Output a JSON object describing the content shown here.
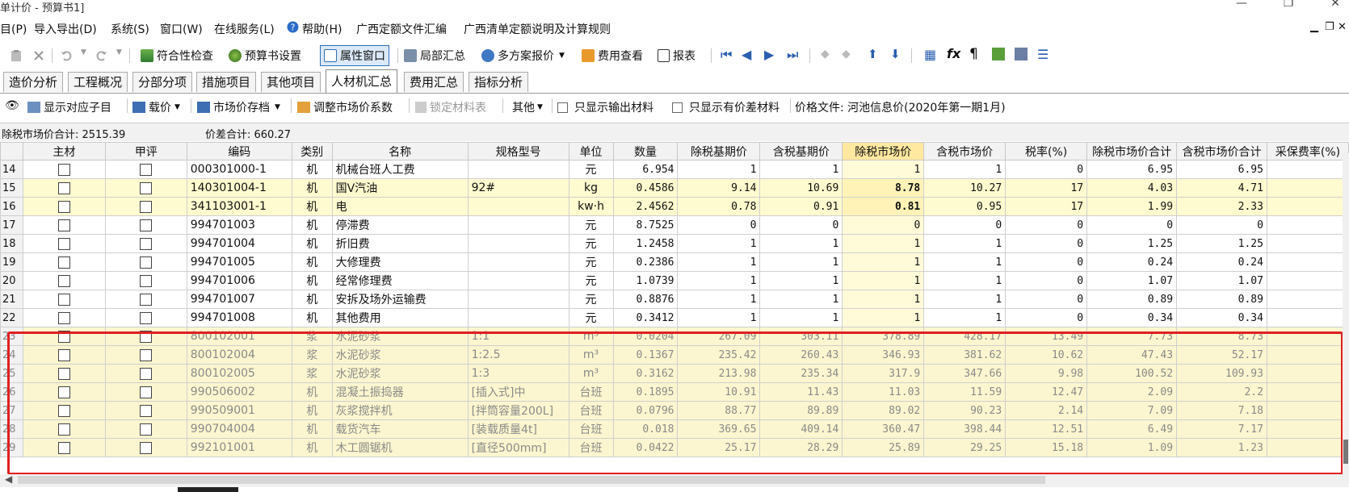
{
  "window": {
    "title": "单计价 - 预算书1]"
  },
  "menu": [
    "目(P)",
    "导入导出(D)",
    "系统(S)",
    "窗口(W)",
    "在线服务(L)",
    "帮助(H)",
    "广西定额文件汇编",
    "广西清单定额说明及计算规则"
  ],
  "toolbar": {
    "compliance_check": "符合性检查",
    "budget_settings": "预算书设置",
    "property_window": "属性窗口",
    "partial_summary": "局部汇总",
    "multi_plan_quote": "多方案报价",
    "cost_view": "费用查看",
    "report": "报表"
  },
  "tabs": [
    "造价分析",
    "工程概况",
    "分部分项",
    "措施项目",
    "其他项目",
    "人材机汇总",
    "费用汇总",
    "指标分析"
  ],
  "active_tab": "人材机汇总",
  "subtoolbar": {
    "show_child": "显示对应子目",
    "load_price": "载价",
    "market_archive": "市场价存档",
    "adjust_coef": "调整市场价系数",
    "lock_table": "锁定材料表",
    "other": "其他",
    "only_output": "只显示输出材料",
    "only_diff": "只显示有价差材料",
    "price_file_label": "价格文件: 河池信息价(2020年第一期1月)"
  },
  "summary": {
    "market_total": "除税市场价合计: 2515.39",
    "diff_total": "价差合计: 660.27"
  },
  "columns": [
    "主材",
    "甲评",
    "编码",
    "类别",
    "名称",
    "规格型号",
    "单位",
    "数量",
    "除税基期价",
    "含税基期价",
    "除税市场价",
    "含税市场价",
    "税率(%)",
    "除税市场价合计",
    "含税市场价合计",
    "采保费率(%)"
  ],
  "rows": [
    {
      "n": "14",
      "code": "000301000-1",
      "cat": "机",
      "name": "机械台班人工费",
      "spec": "",
      "unit": "元",
      "qty": "6.954",
      "b1": "1",
      "b2": "1",
      "m1": "1",
      "m2": "1",
      "tax": "0",
      "t1": "6.95",
      "t2": "6.95"
    },
    {
      "n": "15",
      "code": "140301004-1",
      "cat": "机",
      "name": "国V汽油",
      "spec": "92#",
      "unit": "kg",
      "qty": "0.4586",
      "b1": "9.14",
      "b2": "10.69",
      "m1": "8.78",
      "m2": "10.27",
      "tax": "17",
      "t1": "4.03",
      "t2": "4.71"
    },
    {
      "n": "16",
      "code": "341103001-1",
      "cat": "机",
      "name": "电",
      "spec": "",
      "unit": "kw·h",
      "qty": "2.4562",
      "b1": "0.78",
      "b2": "0.91",
      "m1": "0.81",
      "m2": "0.95",
      "tax": "17",
      "t1": "1.99",
      "t2": "2.33"
    },
    {
      "n": "17",
      "code": "994701003",
      "cat": "机",
      "name": "停滞费",
      "spec": "",
      "unit": "元",
      "qty": "8.7525",
      "b1": "0",
      "b2": "0",
      "m1": "0",
      "m2": "0",
      "tax": "0",
      "t1": "0",
      "t2": "0"
    },
    {
      "n": "18",
      "code": "994701004",
      "cat": "机",
      "name": "折旧费",
      "spec": "",
      "unit": "元",
      "qty": "1.2458",
      "b1": "1",
      "b2": "1",
      "m1": "1",
      "m2": "1",
      "tax": "0",
      "t1": "1.25",
      "t2": "1.25"
    },
    {
      "n": "19",
      "code": "994701005",
      "cat": "机",
      "name": "大修理费",
      "spec": "",
      "unit": "元",
      "qty": "0.2386",
      "b1": "1",
      "b2": "1",
      "m1": "1",
      "m2": "1",
      "tax": "0",
      "t1": "0.24",
      "t2": "0.24"
    },
    {
      "n": "20",
      "code": "994701006",
      "cat": "机",
      "name": "经常修理费",
      "spec": "",
      "unit": "元",
      "qty": "1.0739",
      "b1": "1",
      "b2": "1",
      "m1": "1",
      "m2": "1",
      "tax": "0",
      "t1": "1.07",
      "t2": "1.07"
    },
    {
      "n": "21",
      "code": "994701007",
      "cat": "机",
      "name": "安拆及场外运输费",
      "spec": "",
      "unit": "元",
      "qty": "0.8876",
      "b1": "1",
      "b2": "1",
      "m1": "1",
      "m2": "1",
      "tax": "0",
      "t1": "0.89",
      "t2": "0.89"
    },
    {
      "n": "22",
      "code": "994701008",
      "cat": "机",
      "name": "其他费用",
      "spec": "",
      "unit": "元",
      "qty": "0.3412",
      "b1": "1",
      "b2": "1",
      "m1": "1",
      "m2": "1",
      "tax": "0",
      "t1": "0.34",
      "t2": "0.34"
    },
    {
      "n": "23",
      "code": "800102001",
      "cat": "浆",
      "name": "水泥砂浆",
      "spec": "1:1",
      "unit": "m³",
      "qty": "0.0204",
      "b1": "267.09",
      "b2": "303.11",
      "m1": "378.89",
      "m2": "428.17",
      "tax": "13.49",
      "t1": "7.73",
      "t2": "8.73"
    },
    {
      "n": "24",
      "code": "800102004",
      "cat": "浆",
      "name": "水泥砂浆",
      "spec": "1:2.5",
      "unit": "m³",
      "qty": "0.1367",
      "b1": "235.42",
      "b2": "260.43",
      "m1": "346.93",
      "m2": "381.62",
      "tax": "10.62",
      "t1": "47.43",
      "t2": "52.17"
    },
    {
      "n": "25",
      "code": "800102005",
      "cat": "浆",
      "name": "水泥砂浆",
      "spec": "1:3",
      "unit": "m³",
      "qty": "0.3162",
      "b1": "213.98",
      "b2": "235.34",
      "m1": "317.9",
      "m2": "347.66",
      "tax": "9.98",
      "t1": "100.52",
      "t2": "109.93"
    },
    {
      "n": "26",
      "code": "990506002",
      "cat": "机",
      "name": "混凝土振捣器",
      "spec": "[插入式]中",
      "unit": "台班",
      "qty": "0.1895",
      "b1": "10.91",
      "b2": "11.43",
      "m1": "11.03",
      "m2": "11.59",
      "tax": "12.47",
      "t1": "2.09",
      "t2": "2.2"
    },
    {
      "n": "27",
      "code": "990509001",
      "cat": "机",
      "name": "灰浆搅拌机",
      "spec": "[拌筒容量200L]",
      "unit": "台班",
      "qty": "0.0796",
      "b1": "88.77",
      "b2": "89.89",
      "m1": "89.02",
      "m2": "90.23",
      "tax": "2.14",
      "t1": "7.09",
      "t2": "7.18"
    },
    {
      "n": "28",
      "code": "990704004",
      "cat": "机",
      "name": "载货汽车",
      "spec": "[装载质量4t]",
      "unit": "台班",
      "qty": "0.018",
      "b1": "369.65",
      "b2": "409.14",
      "m1": "360.47",
      "m2": "398.44",
      "tax": "12.51",
      "t1": "6.49",
      "t2": "7.17"
    },
    {
      "n": "29",
      "code": "992101001",
      "cat": "机",
      "name": "木工圆锯机",
      "spec": "[直径500mm]",
      "unit": "台班",
      "qty": "0.0422",
      "b1": "25.17",
      "b2": "28.29",
      "m1": "25.89",
      "m2": "29.25",
      "tax": "15.18",
      "t1": "1.09",
      "t2": "1.23"
    }
  ],
  "colors": {
    "highlight_row": "#fffbd0",
    "header_market": "#ffe8a0",
    "annotation_box": "#e02020",
    "selected_tool": "#dbe9f8"
  }
}
